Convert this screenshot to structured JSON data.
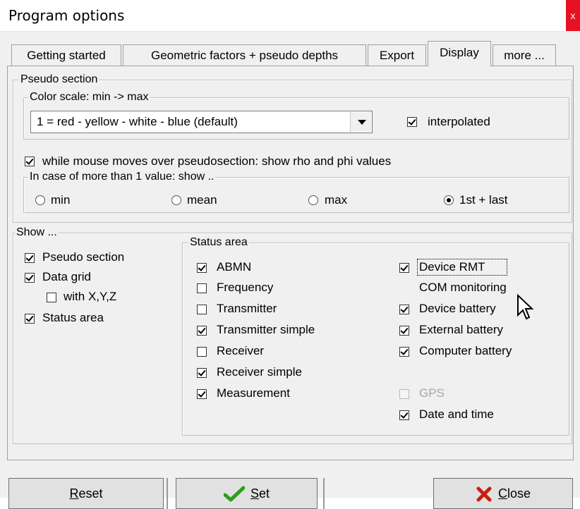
{
  "window": {
    "title": "Program options",
    "close_glyph": "x"
  },
  "tabs": [
    "Getting started",
    "Geometric factors + pseudo depths",
    "Export",
    "Display",
    "more ..."
  ],
  "active_tab": "Display",
  "pseudo_section": {
    "title": "Pseudo section",
    "color_scale": {
      "title": "Color scale: min -> max",
      "selected": "1 = red - yellow - white - blue (default)",
      "interpolated": {
        "label": "interpolated",
        "checked": true
      }
    },
    "mouse_show": {
      "label": "while mouse moves over pseudosection: show rho and phi values",
      "checked": true
    },
    "multi_value": {
      "title": "In case of more than 1 value: show ..",
      "options": [
        {
          "label": "min",
          "selected": false
        },
        {
          "label": "mean",
          "selected": false
        },
        {
          "label": "max",
          "selected": false
        },
        {
          "label": "1st + last",
          "selected": true
        }
      ]
    }
  },
  "show": {
    "title": "Show ...",
    "items": [
      {
        "label": "Pseudo section",
        "checked": true
      },
      {
        "label": "Data grid",
        "checked": true
      },
      {
        "label": "with X,Y,Z",
        "checked": false
      },
      {
        "label": "Status area",
        "checked": true
      }
    ]
  },
  "status_area": {
    "title": "Status area",
    "left": [
      {
        "label": "ABMN",
        "checked": true
      },
      {
        "label": "Frequency",
        "checked": false
      },
      {
        "label": "Transmitter",
        "checked": false
      },
      {
        "label": "Transmitter simple",
        "checked": true
      },
      {
        "label": "Receiver",
        "checked": false
      },
      {
        "label": "Receiver simple",
        "checked": true
      },
      {
        "label": "Measurement",
        "checked": true
      }
    ],
    "right": [
      {
        "label": "Device RMT",
        "checked": true
      },
      {
        "label": "COM monitoring",
        "note": "no checkbox"
      },
      {
        "label": "Device battery",
        "checked": true
      },
      {
        "label": "External battery",
        "checked": true
      },
      {
        "label": "Computer battery",
        "checked": true
      },
      {
        "label": "GPS",
        "checked": false,
        "disabled": true
      },
      {
        "label": "Date and time",
        "checked": true
      }
    ]
  },
  "buttons": {
    "reset": {
      "label": "Reset",
      "mnemonic": "R",
      "rest": "eset"
    },
    "set": {
      "label": "Set",
      "mnemonic": "S",
      "rest": "et",
      "icon": "checkmark-icon",
      "icon_color": "#2e9e1f"
    },
    "close": {
      "label": "Close",
      "mnemonic": "C",
      "rest": "lose",
      "icon": "x-icon",
      "icon_color": "#c81e0f"
    }
  }
}
